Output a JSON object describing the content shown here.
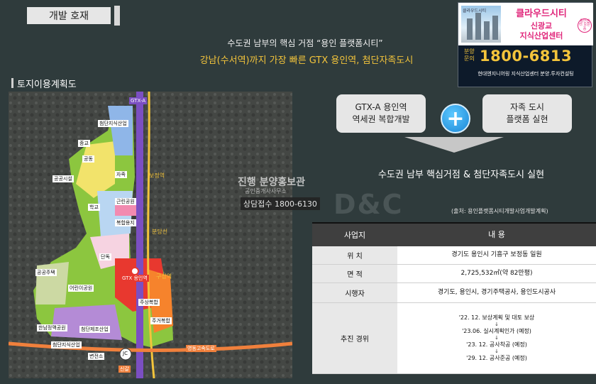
{
  "section_tag": "개발 호재",
  "headline": {
    "line1": "수도권 남부의 핵심 거점 “용인 플랫폼시티”",
    "line2": "강남(수서역)까지 가장 빠른 GTX 용인역, 첨단자족도시"
  },
  "ad": {
    "brand": "클라우드시티",
    "sub1": "신광교",
    "sub2": "지식산업센터",
    "badge": "용인센터 오픈중",
    "photo_label": "클라우드시티",
    "inquiry": "분양 문의",
    "phone": "1800-6813",
    "footer": "현대엔지니어링 지식산업센터 분양.투자컨설팅"
  },
  "map_section": {
    "title": "토지이용계획도",
    "labels": {
      "gtx": "GTX-A",
      "station_bojeong": "보정역",
      "station_guseong": "구성역",
      "station_jukjeon": "분당선",
      "expressway": "영동고속도로",
      "jc": "JC",
      "singal": "신갈",
      "yongin_station": "GTX 용인역",
      "l1": "첨단지식산업",
      "l2": "공동",
      "l3": "종교",
      "l4": "공공시설",
      "l5": "학교",
      "l6": "복합용지",
      "l7": "근린공원",
      "l8": "단독",
      "l9": "주상복합",
      "l10": "공공주택",
      "l11": "한남정맥공원",
      "l12": "첨단지식산업",
      "l13": "첨단제조산업",
      "l14": "변전소",
      "l15": "주거복합",
      "l16": "자족",
      "l17": "어린이공원"
    }
  },
  "concept": {
    "box1_line1": "GTX-A 용인역",
    "box1_line2": "역세권 복합개발",
    "box2_line1": "자족 도시",
    "box2_line2": "플랫폼 실현",
    "plus": "+",
    "result": "수도권 남부 핵심거점 & 첨단자족도시 실현"
  },
  "watermark": {
    "name": "진행 분양홍보관",
    "sub": "공인중개사사무소",
    "phone": "상담접수 1800-6130",
    "brand": "D&C"
  },
  "source": "(출처: 용인플랫폼시티개발사업개발계획)",
  "table": {
    "header": [
      "사업지",
      "내 용"
    ],
    "rows": [
      {
        "label": "위 치",
        "value": "경기도 용인시 기흥구 보정동 일원"
      },
      {
        "label": "면 적",
        "value": "2,725,532㎡(약 82만평)"
      },
      {
        "label": "시행자",
        "value": "경기도, 용인시, 경기주택공사, 용인도시공사"
      }
    ],
    "timeline_label": "추진 경위",
    "timeline": [
      "'22. 12. 보상계획 및 대토 보상",
      "'23.06. 실시계획인가 (예정)",
      "'23. 12. 공사착공 (예정)",
      "'29. 12. 공사준공 (예정)"
    ],
    "arrow": "↓"
  }
}
